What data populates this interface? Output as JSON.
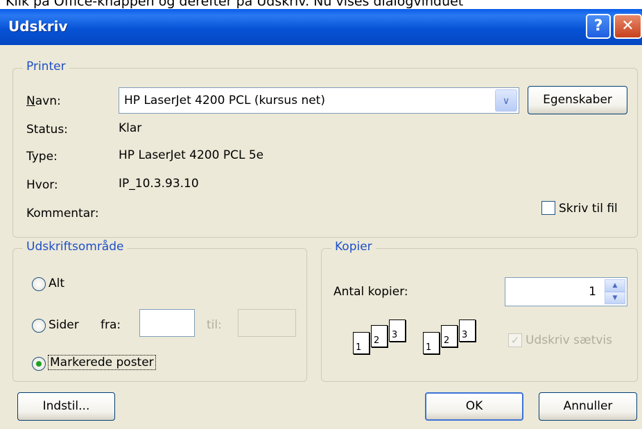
{
  "caption": "Klik på Office-knappen og derefter på Udskriv. Nu vises dialogvinduet",
  "window": {
    "title": "Udskriv",
    "help_label": "?",
    "close_label": "✕"
  },
  "printer": {
    "legend": "Printer",
    "name_label": "Navn:",
    "name_value": "HP LaserJet 4200 PCL (kursus net)",
    "properties_label": "Egenskaber",
    "status_label": "Status:",
    "status_value": "Klar",
    "type_label": "Type:",
    "type_value": "HP LaserJet 4200 PCL 5e",
    "where_label": "Hvor:",
    "where_value": "IP_10.3.93.10",
    "comment_label": "Kommentar:",
    "print_to_file_label": "Skriv til fil",
    "print_to_file_checked": false
  },
  "print_range": {
    "legend": "Udskriftsområde",
    "all_label": "Alt",
    "pages_label": "Sider",
    "from_label": "fra:",
    "to_label": "til:",
    "from_value": "",
    "to_value": "",
    "selection_label": "Markerede poster",
    "selected_option": "Markerede poster"
  },
  "copies": {
    "legend": "Kopier",
    "count_label": "Antal kopier:",
    "count_value": "1",
    "collate_label": "Udskriv sætvis",
    "collate_checked": true,
    "collate_enabled": false,
    "page_numbers": [
      "1",
      "2",
      "3"
    ]
  },
  "buttons": {
    "setup_label": "Indstil...",
    "ok_label": "OK",
    "cancel_label": "Annuller"
  },
  "icons": {
    "dropdown": "chevron-down-icon",
    "help": "question-icon",
    "close": "close-icon"
  },
  "colors": {
    "titlebar": "#0753d6",
    "dialog_bg": "#ece9d8",
    "legend_text": "#1f4fc7",
    "close_button": "#c7401c"
  }
}
